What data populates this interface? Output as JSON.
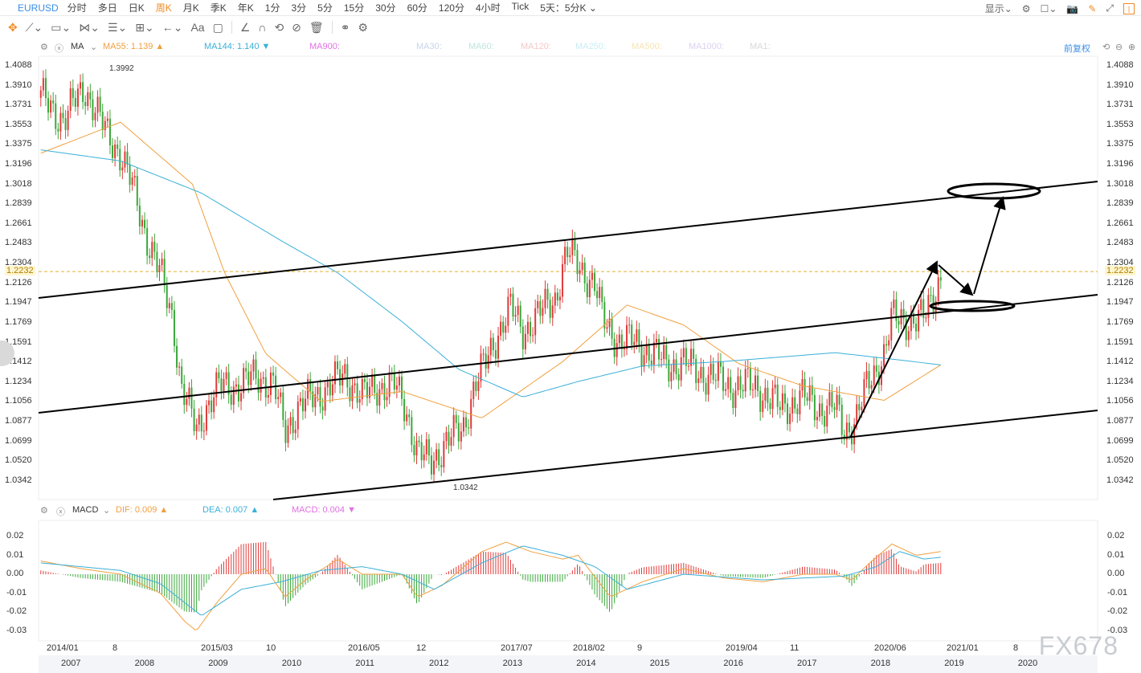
{
  "topbar": {
    "symbol": "EURUSD",
    "periods": [
      "分时",
      "多日",
      "日K",
      "周K",
      "月K",
      "季K",
      "年K",
      "1分",
      "3分",
      "5分",
      "15分",
      "30分",
      "60分",
      "120分",
      "4小时",
      "Tick",
      "5天：5分K ⌄"
    ],
    "active_period": "周K",
    "display": "显示⌄"
  },
  "toolbar": {
    "icons": [
      "move-icon",
      "line-tool-icon",
      "rect-tool-icon",
      "pattern-tool-icon",
      "fib-tool-icon",
      "channel-tool-icon",
      "arrow-tool-icon",
      "text-tool-icon",
      "comment-icon",
      "angle-icon",
      "magnet-icon",
      "sync-icon",
      "hide-icon",
      "delete-icon",
      "link-icon",
      "settings-icon"
    ],
    "text_label": "Aa"
  },
  "legend": {
    "name": "MA",
    "ma55": "MA55: 1.139 ▲",
    "ma144": "MA144: 1.140 ▼",
    "ma900": "MA900:",
    "ma30": "MA30:",
    "ma60": "MA60:",
    "ma120": "MA120:",
    "ma250": "MA250:",
    "ma500": "MA500:",
    "ma1000": "MA1000:",
    "ma1": "MA1:",
    "adjust": "前复权"
  },
  "macd_legend": {
    "name": "MACD",
    "dif": "DIF: 0.009 ▲",
    "dea": "DEA: 0.007 ▲",
    "macd": "MACD: 0.004 ▼"
  },
  "colors": {
    "up": "#e03a3a",
    "down": "#3aa83a",
    "ma55": "#f0a040",
    "ma144": "#3ab0d8",
    "dif": "#f0a040",
    "dea": "#3ab0d8",
    "accent": "#3a8ee6"
  },
  "price_axis": [
    "1.4088",
    "1.3910",
    "1.3731",
    "1.3553",
    "1.3375",
    "1.3196",
    "1.3018",
    "1.2839",
    "1.2661",
    "1.2483",
    "1.2304",
    "1.2126",
    "1.1947",
    "1.1769",
    "1.1591",
    "1.1412",
    "1.1234",
    "1.1056",
    "1.0877",
    "1.0699",
    "1.0520",
    "1.0342"
  ],
  "current_price": "1.2232",
  "high_label": "1.3992",
  "low_label": "1.0342",
  "macd_axis": [
    "0.02",
    "0.01",
    "0.00",
    "-0.01",
    "-0.02",
    "-0.03"
  ],
  "date_axis": [
    "2014/01",
    "8",
    "2015/03",
    "10",
    "2016/05",
    "12",
    "2017/07",
    "2018/02",
    "9",
    "2019/04",
    "11",
    "2020/06",
    "2021/01",
    "8"
  ],
  "year_axis": [
    "2007",
    "2008",
    "2009",
    "2010",
    "2011",
    "2012",
    "2013",
    "2014",
    "2015",
    "2016",
    "2017",
    "2018",
    "2019",
    "2020"
  ],
  "watermark": "FX678",
  "chart_data": {
    "type": "candlestick",
    "ylim": [
      1.0342,
      1.4088
    ],
    "close": [
      [
        2013.88,
        1.38
      ],
      [
        2014.06,
        1.36
      ],
      [
        2014.22,
        1.39
      ],
      [
        2014.38,
        1.35
      ],
      [
        2014.5,
        1.33
      ],
      [
        2014.59,
        1.3
      ],
      [
        2014.69,
        1.26
      ],
      [
        2014.81,
        1.22
      ],
      [
        2014.91,
        1.18
      ],
      [
        2014.97,
        1.12
      ],
      [
        2015.09,
        1.08
      ],
      [
        2015.16,
        1.1
      ],
      [
        2015.28,
        1.12
      ],
      [
        2015.44,
        1.12
      ],
      [
        2015.56,
        1.13
      ],
      [
        2015.69,
        1.12
      ],
      [
        2015.78,
        1.08
      ],
      [
        2015.88,
        1.1
      ],
      [
        2016.0,
        1.11
      ],
      [
        2016.13,
        1.12
      ],
      [
        2016.25,
        1.13
      ],
      [
        2016.38,
        1.11
      ],
      [
        2016.5,
        1.12
      ],
      [
        2016.63,
        1.12
      ],
      [
        2016.72,
        1.1
      ],
      [
        2016.81,
        1.06
      ],
      [
        2016.91,
        1.05
      ],
      [
        2017.03,
        1.07
      ],
      [
        2017.16,
        1.08
      ],
      [
        2017.25,
        1.12
      ],
      [
        2017.34,
        1.14
      ],
      [
        2017.44,
        1.17
      ],
      [
        2017.53,
        1.19
      ],
      [
        2017.63,
        1.17
      ],
      [
        2017.72,
        1.18
      ],
      [
        2017.88,
        1.2
      ],
      [
        2017.97,
        1.24
      ],
      [
        2018.06,
        1.23
      ],
      [
        2018.19,
        1.21
      ],
      [
        2018.25,
        1.18
      ],
      [
        2018.38,
        1.16
      ],
      [
        2018.5,
        1.16
      ],
      [
        2018.63,
        1.15
      ],
      [
        2018.75,
        1.14
      ],
      [
        2018.88,
        1.14
      ],
      [
        2019.06,
        1.13
      ],
      [
        2019.25,
        1.12
      ],
      [
        2019.44,
        1.12
      ],
      [
        2019.63,
        1.1
      ],
      [
        2019.81,
        1.11
      ],
      [
        2019.94,
        1.1
      ],
      [
        2020.06,
        1.1
      ],
      [
        2020.13,
        1.08
      ],
      [
        2020.22,
        1.09
      ],
      [
        2020.31,
        1.12
      ],
      [
        2020.44,
        1.15
      ],
      [
        2020.5,
        1.18
      ],
      [
        2020.63,
        1.18
      ],
      [
        2020.75,
        1.18
      ],
      [
        2020.88,
        1.22
      ]
    ],
    "ma55": [
      [
        2013.88,
        1.33
      ],
      [
        2014.5,
        1.358
      ],
      [
        2015.06,
        1.302
      ],
      [
        2015.31,
        1.222
      ],
      [
        2015.63,
        1.149
      ],
      [
        2016.06,
        1.106
      ],
      [
        2016.69,
        1.115
      ],
      [
        2017.31,
        1.091
      ],
      [
        2017.94,
        1.142
      ],
      [
        2018.44,
        1.193
      ],
      [
        2018.88,
        1.175
      ],
      [
        2019.31,
        1.14
      ],
      [
        2019.81,
        1.12
      ],
      [
        2020.44,
        1.107
      ],
      [
        2020.88,
        1.139
      ]
    ],
    "ma144": [
      [
        2013.88,
        1.333
      ],
      [
        2014.5,
        1.323
      ],
      [
        2015.13,
        1.294
      ],
      [
        2015.75,
        1.251
      ],
      [
        2016.19,
        1.222
      ],
      [
        2016.69,
        1.178
      ],
      [
        2017.13,
        1.135
      ],
      [
        2017.63,
        1.11
      ],
      [
        2018.06,
        1.124
      ],
      [
        2018.56,
        1.138
      ],
      [
        2019.19,
        1.142
      ],
      [
        2020.06,
        1.15
      ],
      [
        2020.44,
        1.145
      ],
      [
        2020.88,
        1.139
      ]
    ],
    "dif": [
      [
        2013.88,
        0.007
      ],
      [
        2014.19,
        0.003
      ],
      [
        2014.5,
        0.0
      ],
      [
        2014.81,
        -0.01
      ],
      [
        2015.0,
        -0.025
      ],
      [
        2015.09,
        -0.03
      ],
      [
        2015.25,
        -0.015
      ],
      [
        2015.44,
        0.0
      ],
      [
        2015.63,
        0.003
      ],
      [
        2015.78,
        -0.012
      ],
      [
        2015.94,
        -0.003
      ],
      [
        2016.19,
        0.008
      ],
      [
        2016.38,
        0.0
      ],
      [
        2016.69,
        0.0
      ],
      [
        2016.81,
        -0.012
      ],
      [
        2017.0,
        -0.006
      ],
      [
        2017.31,
        0.012
      ],
      [
        2017.5,
        0.017
      ],
      [
        2017.69,
        0.012
      ],
      [
        2017.94,
        0.008
      ],
      [
        2018.06,
        0.01
      ],
      [
        2018.31,
        -0.012
      ],
      [
        2018.56,
        -0.004
      ],
      [
        2018.88,
        0.003
      ],
      [
        2019.19,
        -0.002
      ],
      [
        2019.5,
        -0.004
      ],
      [
        2019.81,
        0.0
      ],
      [
        2020.06,
        0.0
      ],
      [
        2020.19,
        -0.003
      ],
      [
        2020.31,
        0.005
      ],
      [
        2020.5,
        0.016
      ],
      [
        2020.69,
        0.01
      ],
      [
        2020.88,
        0.012
      ]
    ],
    "dea": [
      [
        2013.88,
        0.006
      ],
      [
        2014.5,
        0.002
      ],
      [
        2014.81,
        -0.005
      ],
      [
        2015.13,
        -0.022
      ],
      [
        2015.44,
        -0.008
      ],
      [
        2015.75,
        -0.004
      ],
      [
        2016.06,
        0.002
      ],
      [
        2016.38,
        0.004
      ],
      [
        2016.69,
        0.0
      ],
      [
        2016.94,
        -0.008
      ],
      [
        2017.31,
        0.006
      ],
      [
        2017.63,
        0.015
      ],
      [
        2017.94,
        0.01
      ],
      [
        2018.19,
        0.004
      ],
      [
        2018.44,
        -0.008
      ],
      [
        2018.88,
        0.0
      ],
      [
        2019.5,
        -0.003
      ],
      [
        2020.13,
        -0.001
      ],
      [
        2020.38,
        0.004
      ],
      [
        2020.56,
        0.012
      ],
      [
        2020.75,
        0.008
      ],
      [
        2020.88,
        0.009
      ]
    ],
    "macd_ylim": [
      -0.03,
      0.02
    ]
  }
}
